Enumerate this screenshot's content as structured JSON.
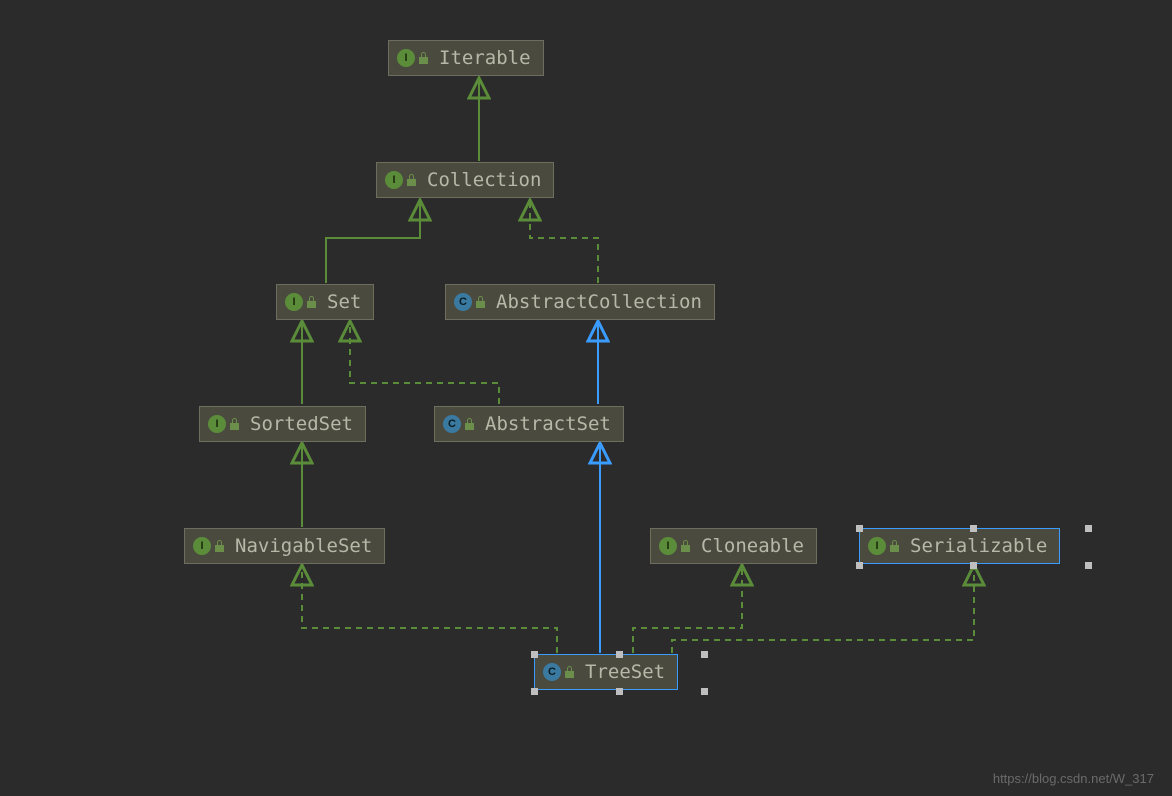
{
  "nodes": {
    "iterable": {
      "label": "Iterable",
      "type": "interface"
    },
    "collection": {
      "label": "Collection",
      "type": "interface"
    },
    "set": {
      "label": "Set",
      "type": "interface"
    },
    "abstractcollection": {
      "label": "AbstractCollection",
      "type": "abstract"
    },
    "sortedset": {
      "label": "SortedSet",
      "type": "interface"
    },
    "abstractset": {
      "label": "AbstractSet",
      "type": "abstract"
    },
    "navigableset": {
      "label": "NavigableSet",
      "type": "interface"
    },
    "cloneable": {
      "label": "Cloneable",
      "type": "interface"
    },
    "serializable": {
      "label": "Serializable",
      "type": "interface"
    },
    "treeset": {
      "label": "TreeSet",
      "type": "class"
    }
  },
  "icon_letters": {
    "interface": "I",
    "class": "C",
    "abstract": "C"
  },
  "colors": {
    "implements_edge": "#5b8c3a",
    "extends_edge": "#3b9cff",
    "node_bg": "#4a4a3f",
    "node_border": "#6e6e5e",
    "selected_border": "#3b9cff",
    "canvas_bg": "#2b2b2b"
  },
  "edges": [
    {
      "from": "collection",
      "to": "iterable",
      "style": "solid",
      "color": "implements"
    },
    {
      "from": "set",
      "to": "collection",
      "style": "solid",
      "color": "implements"
    },
    {
      "from": "abstractcollection",
      "to": "collection",
      "style": "dashed",
      "color": "implements"
    },
    {
      "from": "sortedset",
      "to": "set",
      "style": "solid",
      "color": "implements"
    },
    {
      "from": "abstractset",
      "to": "set",
      "style": "dashed",
      "color": "implements"
    },
    {
      "from": "abstractset",
      "to": "abstractcollection",
      "style": "solid",
      "color": "extends"
    },
    {
      "from": "navigableset",
      "to": "sortedset",
      "style": "solid",
      "color": "implements"
    },
    {
      "from": "treeset",
      "to": "navigableset",
      "style": "dashed",
      "color": "implements"
    },
    {
      "from": "treeset",
      "to": "abstractset",
      "style": "solid",
      "color": "extends"
    },
    {
      "from": "treeset",
      "to": "cloneable",
      "style": "dashed",
      "color": "implements"
    },
    {
      "from": "treeset",
      "to": "serializable",
      "style": "dashed",
      "color": "implements"
    }
  ],
  "selected": [
    "serializable",
    "treeset"
  ],
  "watermark": "https://blog.csdn.net/W_317"
}
